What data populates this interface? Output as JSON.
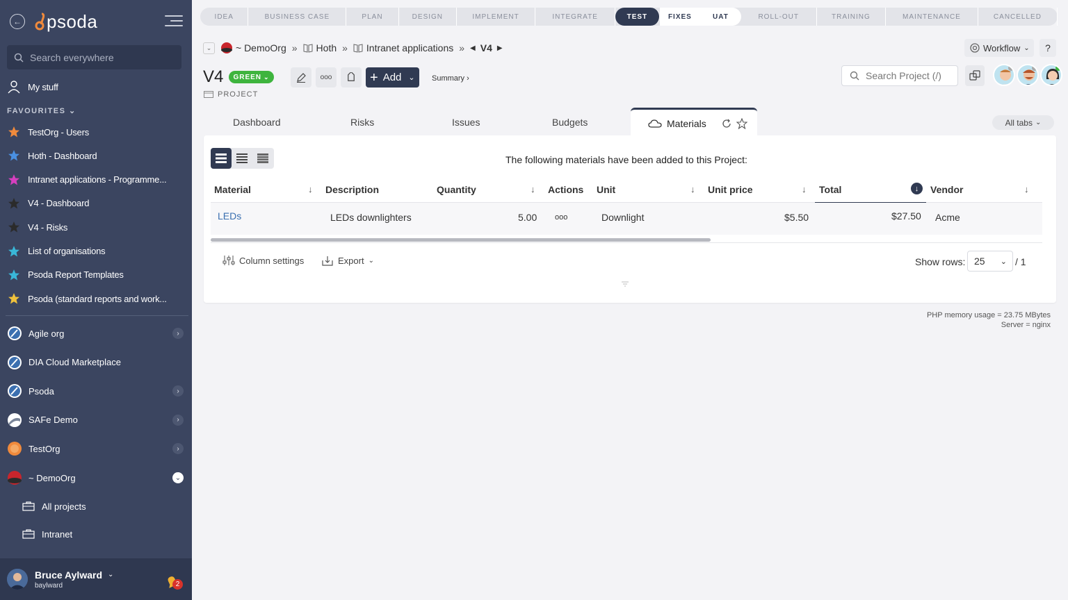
{
  "sidebar": {
    "logo_text": "psoda",
    "search_placeholder": "Search everywhere",
    "my_stuff": "My stuff",
    "favourites_heading": "FAVOURITES",
    "favourites": [
      {
        "label": "TestOrg - Users",
        "color": "#f08a3c"
      },
      {
        "label": "Hoth - Dashboard",
        "color": "#4a90e2"
      },
      {
        "label": "Intranet applications - Programme...",
        "color": "#d63fbf"
      },
      {
        "label": "V4 - Dashboard",
        "color": "#2b2b2b"
      },
      {
        "label": "V4 - Risks",
        "color": "#2b2b2b"
      },
      {
        "label": "List of organisations",
        "color": "#39b7d8"
      },
      {
        "label": "Psoda Report Templates",
        "color": "#39b7d8"
      },
      {
        "label": "Psoda (standard reports and work...",
        "color": "#f0c23c"
      }
    ],
    "orgs": [
      {
        "label": "Agile org",
        "expandable": true
      },
      {
        "label": "DIA Cloud Marketplace",
        "expandable": false
      },
      {
        "label": "Psoda",
        "expandable": true
      },
      {
        "label": "SAFe Demo",
        "expandable": true
      },
      {
        "label": "TestOrg",
        "expandable": true
      },
      {
        "label": "~ DemoOrg",
        "expandable": true
      }
    ],
    "sub_items": [
      "All projects",
      "Intranet"
    ],
    "user": {
      "name": "Bruce Aylward",
      "username": "baylward",
      "notifications": "2"
    }
  },
  "phases": [
    {
      "label": "IDEA",
      "state": "past"
    },
    {
      "label": "BUSINESS CASE",
      "state": "past"
    },
    {
      "label": "PLAN",
      "state": "past"
    },
    {
      "label": "DESIGN",
      "state": "past"
    },
    {
      "label": "IMPLEMENT",
      "state": "past"
    },
    {
      "label": "INTEGRATE",
      "state": "past"
    },
    {
      "label": "TEST",
      "state": "current"
    },
    {
      "label": "FIXES",
      "state": "active"
    },
    {
      "label": "UAT",
      "state": "active"
    },
    {
      "label": "ROLL-OUT",
      "state": "future"
    },
    {
      "label": "TRAINING",
      "state": "future"
    },
    {
      "label": "MAINTENANCE",
      "state": "future"
    },
    {
      "label": "CANCELLED",
      "state": "future"
    }
  ],
  "breadcrumb": {
    "org": "~ DemoOrg",
    "crumb1": "Hoth",
    "crumb2": "Intranet applications",
    "current": "V4"
  },
  "workflow_label": "Workflow",
  "help_label": "?",
  "project": {
    "title": "V4",
    "status": "GREEN",
    "type_label": "PROJECT",
    "status_color": "#3eb43e"
  },
  "toolbar": {
    "add_label": "Add",
    "summary_label": "Summary ›",
    "search_placeholder": "Search Project (/)"
  },
  "tabs": [
    "Dashboard",
    "Risks",
    "Issues",
    "Budgets"
  ],
  "active_tab": "Materials",
  "all_tabs_label": "All tabs",
  "materials": {
    "intro": "The following materials have been added to this Project:",
    "columns": [
      "Material",
      "Description",
      "Quantity",
      "Actions",
      "Unit",
      "Unit price",
      "Total",
      "Vendor"
    ],
    "rows": [
      {
        "material": "LEDs",
        "description": "LEDs downlighters",
        "quantity": "5.00",
        "actions": "ooo",
        "unit": "Downlight",
        "unit_price": "$5.50",
        "total": "$27.50",
        "vendor": "Acme"
      }
    ],
    "column_settings": "Column settings",
    "export": "Export",
    "show_rows_label": "Show rows:",
    "rows_per_page": "25",
    "pages": "/ 1"
  },
  "footer": {
    "memory": "PHP memory usage = 23.75 MBytes",
    "server": "Server = nginx"
  },
  "colors": {
    "sidebar": "#3b4560",
    "accent": "#303a52",
    "link": "#3a6fb0"
  }
}
